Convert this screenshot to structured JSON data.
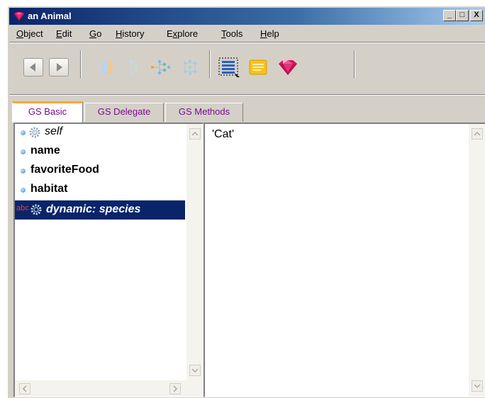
{
  "window": {
    "title": "an Animal",
    "minimize": "_",
    "maximize": "□",
    "close": "X"
  },
  "menu": [
    {
      "underline": "O",
      "rest": "bject"
    },
    {
      "underline": "E",
      "rest": "dit"
    },
    {
      "underline": "G",
      "rest": "o"
    },
    {
      "underline": "H",
      "rest": "istory"
    },
    {
      "pre": "E",
      "underline": "x",
      "rest": "plore"
    },
    {
      "underline": "T",
      "rest": "ools"
    },
    {
      "underline": "H",
      "rest": "elp"
    }
  ],
  "tabs": [
    {
      "label": "GS Basic",
      "active": true
    },
    {
      "label": "GS Delegate",
      "active": false
    },
    {
      "label": "GS Methods",
      "active": false
    }
  ],
  "list": {
    "items": [
      {
        "label": "self",
        "style": "italic",
        "icon": "gear-icon"
      },
      {
        "label": "name",
        "style": "bold"
      },
      {
        "label": "favoriteFood",
        "style": "bold"
      },
      {
        "label": "habitat",
        "style": "bold"
      },
      {
        "label": "dynamic: species",
        "style": "bold-italic",
        "icon": "abc-gear-icon",
        "selected": true
      }
    ]
  },
  "value": {
    "text": "'Cat'"
  },
  "icons": {
    "toolbar": [
      "back-arrow-icon",
      "forward-arrow-icon",
      "sphere-icon",
      "hierarchy-icon",
      "expand-tree-icon",
      "class-tree-icon",
      "list-view-icon",
      "notes-icon",
      "gem-icon"
    ]
  },
  "colors": {
    "titlebar": "#0a246a",
    "selection": "#0a246a",
    "tab_text": "#7a0a8f",
    "tab_accent": "#ffa733",
    "gem": "#d4145a"
  }
}
